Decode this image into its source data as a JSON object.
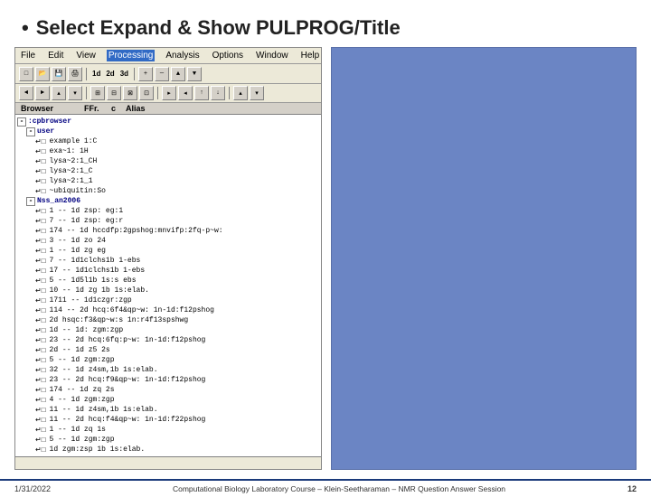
{
  "slide": {
    "title_bullet": "•",
    "title_text": "Select Expand & Show PULPROG/Title"
  },
  "menu": {
    "items": [
      "File",
      "Edit",
      "View",
      "Processing",
      "Analysis",
      "Options",
      "Window",
      "Help"
    ],
    "active_index": 3
  },
  "toolbar": {
    "buttons": [
      "□",
      "↩",
      "■",
      "►",
      "|",
      "1d",
      "2d",
      "3d",
      "|",
      "+",
      "■"
    ],
    "buttons2": [
      "◄",
      "►",
      "▲",
      "▼",
      "|",
      "⊞",
      "⊟",
      "⊠",
      "⊡",
      "|",
      "▸",
      "◂",
      "↑",
      "↓",
      "|",
      "▴",
      "▾"
    ]
  },
  "columns": {
    "browser": "Browser",
    "ffr": "FFr.",
    "c": "c",
    "alias": "Alias"
  },
  "tree": {
    "items": [
      {
        "indent": 0,
        "expand": "-",
        "checkbox": false,
        "label": ":cpbrowser",
        "type": "folder"
      },
      {
        "indent": 1,
        "expand": "-",
        "checkbox": false,
        "label": "user",
        "type": "folder"
      },
      {
        "indent": 2,
        "expand": null,
        "checkbox": true,
        "label": "example 1:C",
        "type": "file"
      },
      {
        "indent": 2,
        "expand": null,
        "checkbox": true,
        "label": "exa~1: 1H",
        "type": "file"
      },
      {
        "indent": 2,
        "expand": null,
        "checkbox": true,
        "label": "lysa~2:1_CH",
        "type": "file"
      },
      {
        "indent": 2,
        "expand": null,
        "checkbox": true,
        "label": "lysa~2:1_C",
        "type": "file"
      },
      {
        "indent": 2,
        "expand": null,
        "checkbox": true,
        "label": "lysa~2:1_1",
        "type": "file"
      },
      {
        "indent": 2,
        "expand": null,
        "checkbox": true,
        "label": "~ubiquitin:So",
        "type": "file"
      },
      {
        "indent": 1,
        "expand": "-",
        "checkbox": false,
        "label": "Nss_an2006",
        "type": "folder"
      },
      {
        "indent": 2,
        "expand": null,
        "checkbox": true,
        "label": "1 -- 1d zsp: eg:1",
        "type": "file"
      },
      {
        "indent": 2,
        "expand": null,
        "checkbox": true,
        "label": "7 -- 1d zsp: eg:r",
        "type": "file"
      },
      {
        "indent": 2,
        "expand": null,
        "checkbox": true,
        "label": "174 -- 1d hccdfp:2gpshog:mnvifp:2fq-p~w:",
        "type": "file"
      },
      {
        "indent": 2,
        "expand": null,
        "checkbox": true,
        "label": "3 -- 1d zo 24",
        "type": "file"
      },
      {
        "indent": 2,
        "expand": null,
        "checkbox": true,
        "label": "1 -- 1d zg eg",
        "type": "file"
      },
      {
        "indent": 2,
        "expand": null,
        "checkbox": true,
        "label": "7 -- 1d1clchs1b 1-ebs",
        "type": "file"
      },
      {
        "indent": 2,
        "expand": null,
        "checkbox": true,
        "label": "17 -- 1d1clchs1b 1-ebs",
        "type": "file"
      },
      {
        "indent": 2,
        "expand": null,
        "checkbox": true,
        "label": "5 -- 1d5l1b 1s:s ebs",
        "type": "file"
      },
      {
        "indent": 2,
        "expand": null,
        "checkbox": true,
        "label": "10 -- 1d zg 1b 1s:elab.",
        "type": "file"
      },
      {
        "indent": 2,
        "expand": null,
        "checkbox": true,
        "label": "1711 -- 1d1czgr:zgp",
        "type": "file"
      },
      {
        "indent": 2,
        "expand": null,
        "checkbox": true,
        "label": "114 -- 2d hcq:6f4&qp~w: 1n-1d:f12pshog",
        "type": "file"
      },
      {
        "indent": 2,
        "expand": null,
        "checkbox": true,
        "label": "1b  2d hsqc:f3&qp~w:s 1n:r4f13spshwg",
        "type": "file"
      },
      {
        "indent": 2,
        "expand": null,
        "checkbox": true,
        "label": "1d -- 1d: zgm:zgp",
        "type": "file"
      },
      {
        "indent": 2,
        "expand": null,
        "checkbox": true,
        "label": "23 -- 2d hcq:6fq:p~w: 1n-1d:f12pshog",
        "type": "file"
      },
      {
        "indent": 2,
        "expand": null,
        "checkbox": true,
        "label": "2d -- 1d z5 2s",
        "type": "file"
      },
      {
        "indent": 2,
        "expand": null,
        "checkbox": true,
        "label": "5 -- 1d zgm:zgp",
        "type": "file"
      },
      {
        "indent": 2,
        "expand": null,
        "checkbox": true,
        "label": "32 -- 1d z4sm,1b 1s:elab.",
        "type": "file"
      },
      {
        "indent": 2,
        "expand": null,
        "checkbox": true,
        "label": "23 -- 2d hcq:f9&qp~w: 1n-1d:f12pshog",
        "type": "file"
      },
      {
        "indent": 2,
        "expand": null,
        "checkbox": true,
        "label": "174 -- 1d zq 2s",
        "type": "file"
      },
      {
        "indent": 2,
        "expand": null,
        "checkbox": true,
        "label": "4 -- 1d zgm:zgp",
        "type": "file"
      },
      {
        "indent": 2,
        "expand": null,
        "checkbox": true,
        "label": "11 -- 1d z4sm,1b 1s:elab.",
        "type": "file"
      },
      {
        "indent": 2,
        "expand": null,
        "checkbox": true,
        "label": "11 -- 2d hcq:f4&qp~w: 1n-1d:f22pshog",
        "type": "file"
      },
      {
        "indent": 2,
        "expand": null,
        "checkbox": true,
        "label": "1 -- 1d zq 1s",
        "type": "file"
      },
      {
        "indent": 2,
        "expand": null,
        "checkbox": true,
        "label": "5 -- 1d zgm:zgp",
        "type": "file"
      },
      {
        "indent": 2,
        "expand": null,
        "checkbox": true,
        "label": "1d zgm:zsp 1b 1s:elab.",
        "type": "file"
      }
    ]
  },
  "footer": {
    "date": "1/31/2022",
    "center_text": "Computational Biology Laboratory Course – Klein-Seetharaman – NMR Question Answer Session",
    "page": "12"
  }
}
